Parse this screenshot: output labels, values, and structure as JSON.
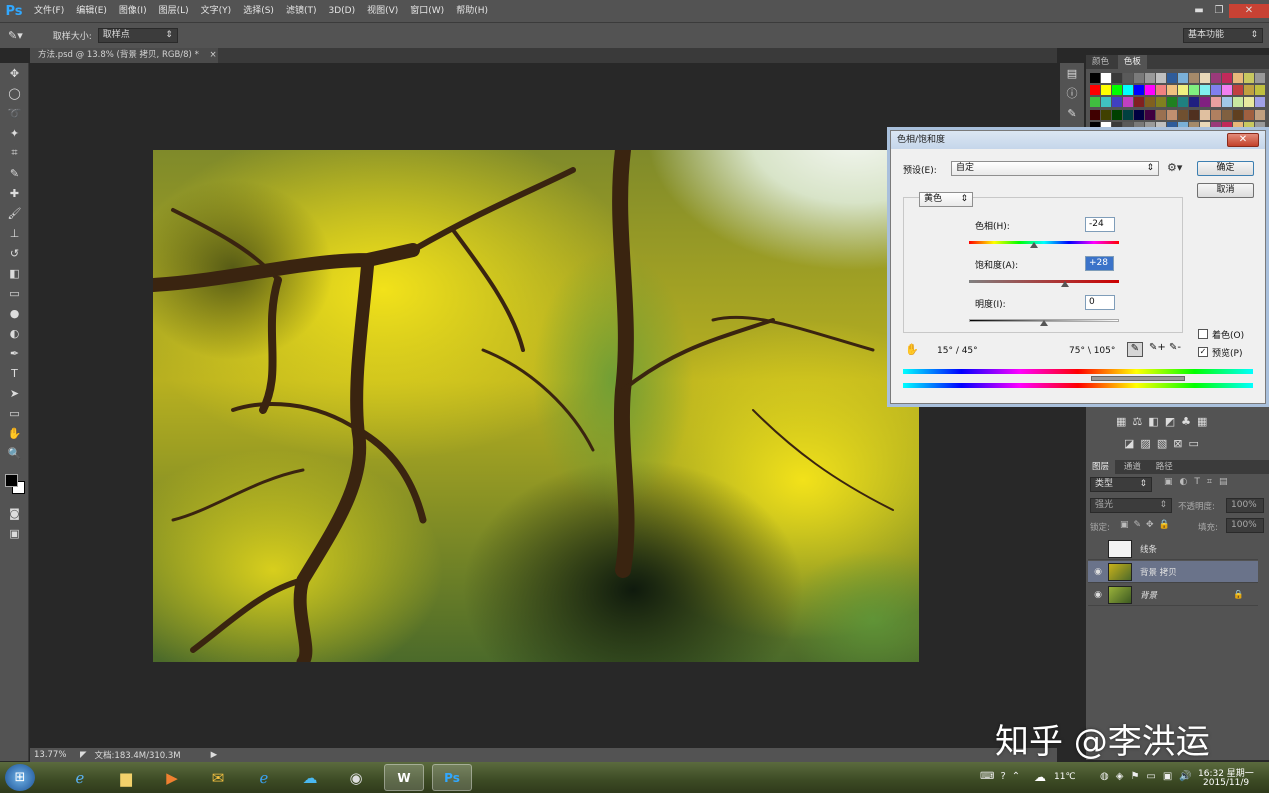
{
  "app": {
    "logo": "Ps"
  },
  "menu": [
    "文件(F)",
    "编辑(E)",
    "图像(I)",
    "图层(L)",
    "文字(Y)",
    "选择(S)",
    "滤镜(T)",
    "3D(D)",
    "视图(V)",
    "窗口(W)",
    "帮助(H)"
  ],
  "window_controls": {
    "minimize": "▬",
    "restore": "❐",
    "close": "✕"
  },
  "options_bar": {
    "sample_size_label": "取样大小:",
    "sample_size_value": "取样点",
    "workspace": "基本功能"
  },
  "document_tab": {
    "title": "方法.psd @ 13.8% (背景 拷贝, RGB/8) *",
    "close": "×"
  },
  "status": {
    "zoom": "13.77%",
    "doc_info": "文档:183.4M/310.3M"
  },
  "swatch_panel": {
    "tabs": [
      "颜色",
      "色板"
    ],
    "colors": [
      "#000000",
      "#ffffff",
      "#3a3a3a",
      "#5a5a5a",
      "#7a7a7a",
      "#9a9a9a",
      "#c0c0c0",
      "#2f5c9a",
      "#7ab0d8",
      "#a58a6a",
      "#e8d8b8",
      "#9a3a7a",
      "#c02a5a",
      "#e8b87a",
      "#c8c860",
      "#9a9a9a"
    ]
  },
  "dialog": {
    "title": "色相/饱和度",
    "close": "✕",
    "preset_label": "预设(E):",
    "preset_value": "自定",
    "ok": "确定",
    "cancel": "取消",
    "channel": "黄色",
    "hue_label": "色相(H):",
    "hue_value": "-24",
    "sat_label": "饱和度(A):",
    "sat_value": "+28",
    "light_label": "明度(I):",
    "light_value": "0",
    "range_left": "15° / 45°",
    "range_right": "75° \\ 105°",
    "colorize_label": "着色(O)",
    "preview_label": "预览(P)",
    "colorize_checked": false,
    "preview_checked": true
  },
  "layers_panel": {
    "tabs": [
      "图层",
      "通道",
      "路径"
    ],
    "filter_label": "类型",
    "blend_mode": "强光",
    "opacity_label": "不透明度:",
    "opacity_value": "100%",
    "lock_label": "锁定:",
    "fill_label": "填充:",
    "fill_value": "100%",
    "layers": [
      {
        "name": "线条",
        "visible": false,
        "selected": false,
        "locked": false
      },
      {
        "name": "背景 拷贝",
        "visible": true,
        "selected": true,
        "locked": false
      },
      {
        "name": "背景",
        "visible": true,
        "selected": false,
        "locked": true
      }
    ]
  },
  "taskbar": {
    "weather": "11℃",
    "time": "16:32 星期一",
    "date": "2015/11/9"
  },
  "watermark": "知乎 @李洪运"
}
